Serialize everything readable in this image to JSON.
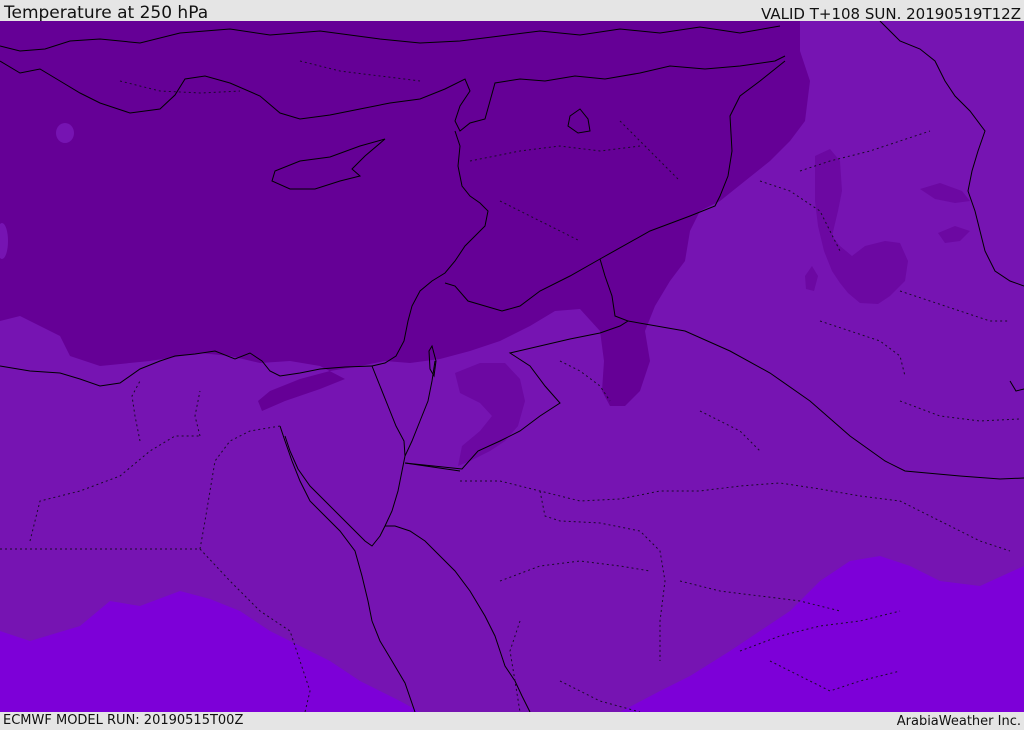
{
  "header": {
    "title": "Temperature at 250 hPa",
    "valid_time": "VALID T+108 SUN. 20190519T12Z"
  },
  "footer": {
    "model_run": "ECMWF MODEL RUN: 20190515T00Z",
    "credit": "ArabiaWeather Inc."
  },
  "colors": {
    "coldest": "#650096",
    "mid": "#7614b2",
    "base": "#7b16b8",
    "warm": "#7d00d8",
    "coast_line": "#000000",
    "border_dotted": "#1a0a2a"
  }
}
